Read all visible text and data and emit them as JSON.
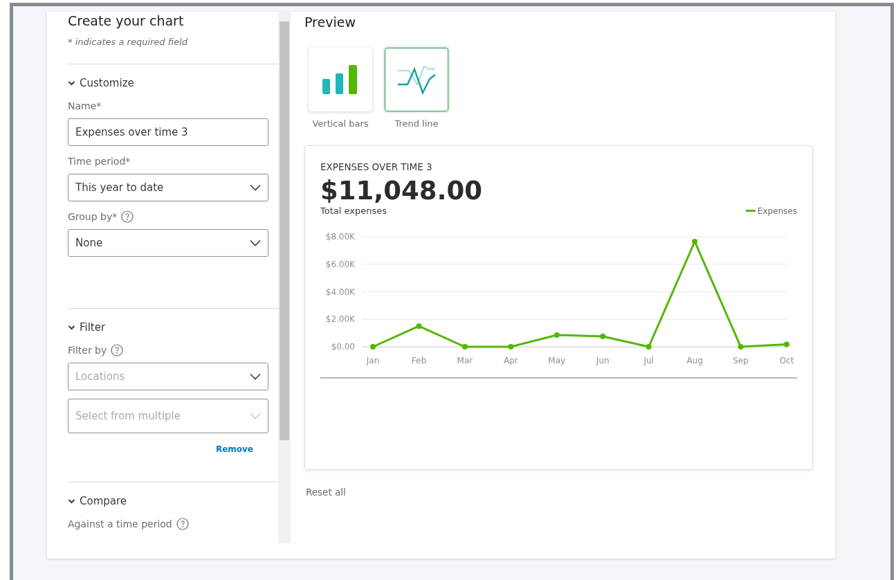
{
  "panel": {
    "title": "Create your chart",
    "note": "* indicates a required field",
    "sections": [
      {
        "title": "Customize",
        "expanded": true,
        "fields": [
          {
            "kind": "text",
            "label": "Name*",
            "value": "Expenses over time 3"
          },
          {
            "kind": "select",
            "label": "Time period*",
            "value": "This year to date"
          },
          {
            "kind": "select",
            "label": "Group by*",
            "help": true,
            "value": "None"
          }
        ]
      },
      {
        "title": "Filter",
        "expanded": true,
        "fields": [
          {
            "kind": "select",
            "label": "Filter by",
            "help": true,
            "placeholder": "Locations"
          },
          {
            "kind": "multiselect",
            "placeholder": "Select from multiple"
          }
        ],
        "action": "Remove"
      },
      {
        "title": "Compare",
        "expanded": true,
        "fields": [
          {
            "kind": "label",
            "label": "Against a time period",
            "help": true
          }
        ]
      }
    ]
  },
  "preview": {
    "title": "Preview",
    "chart_types": [
      {
        "label": "Vertical bars",
        "kind": "bars",
        "selected": false
      },
      {
        "label": "Trend line",
        "kind": "line",
        "selected": true
      }
    ],
    "card": {
      "title": "EXPENSES OVER TIME 3",
      "amount": "$11,048.00",
      "subtitle": "Total expenses",
      "chart_data": {
        "type": "line",
        "grid": true,
        "categories": [
          "Jan",
          "Feb",
          "Mar",
          "Apr",
          "May",
          "Jun",
          "Jul",
          "Aug",
          "Sep",
          "Oct"
        ],
        "ylim": [
          0,
          8000
        ],
        "yticks": [
          {
            "value": 0,
            "label": "$0.00"
          },
          {
            "value": 2000,
            "label": "$2.00K"
          },
          {
            "value": 4000,
            "label": "$4.00K"
          },
          {
            "value": 6000,
            "label": "$6.00K"
          },
          {
            "value": 8000,
            "label": "$8.00K"
          }
        ],
        "series": [
          {
            "name": "Expenses",
            "color": "#53b700",
            "marker": true,
            "values": [
              0,
              1500,
              0,
              0,
              850,
              750,
              0,
              7650,
              0,
              180
            ]
          }
        ]
      }
    },
    "reset": "Reset all"
  }
}
